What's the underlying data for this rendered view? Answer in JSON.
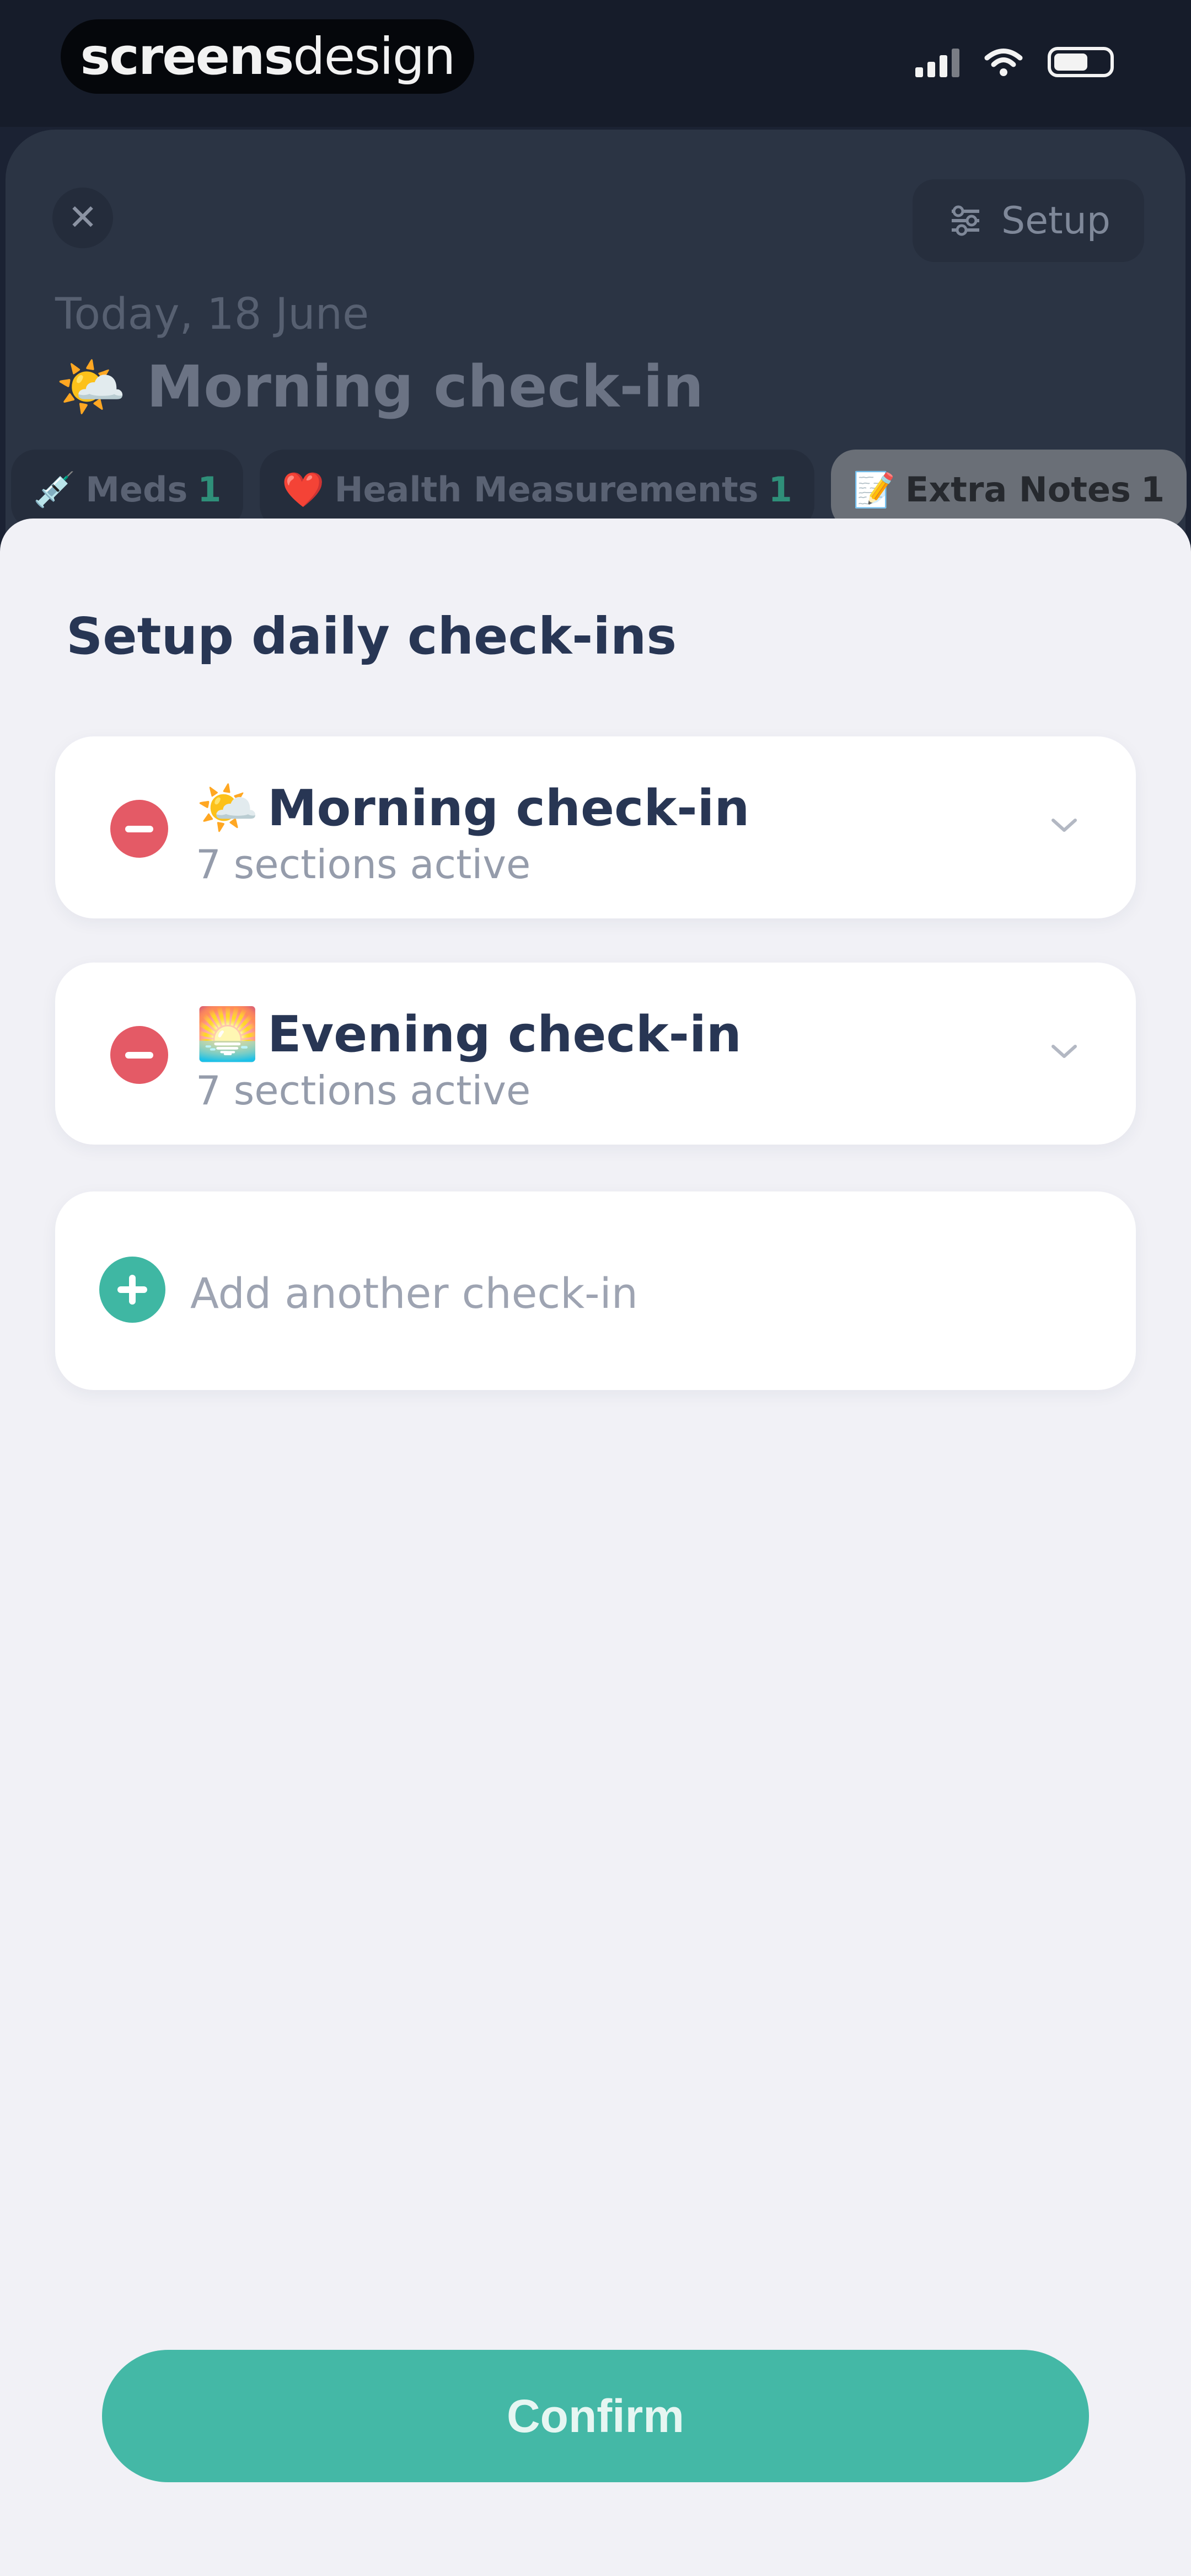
{
  "status_bar": {
    "brand_part1": "screens",
    "brand_part2": "design"
  },
  "background": {
    "close_label": "✕",
    "setup_label": "Setup",
    "date": "Today, 18 June",
    "title_emoji": "🌤️",
    "title": "Morning check-in",
    "chips": [
      {
        "emoji": "💉",
        "label": "Meds",
        "count": "1"
      },
      {
        "emoji": "❤️",
        "label": "Health Measurements",
        "count": "1"
      },
      {
        "emoji": "📝",
        "label": "Extra Notes",
        "count": "1"
      }
    ]
  },
  "sheet": {
    "title": "Setup daily check-ins",
    "checkins": [
      {
        "emoji": "🌤️",
        "name": "Morning check-in",
        "sub": "7 sections active"
      },
      {
        "emoji": "🌅",
        "name": "Evening check-in",
        "sub": "7 sections active"
      }
    ],
    "add_label": "Add another check-in",
    "confirm_label": "Confirm"
  },
  "colors": {
    "accent": "#44b8a6",
    "remove": "#e45a66",
    "title_text": "#283654"
  }
}
